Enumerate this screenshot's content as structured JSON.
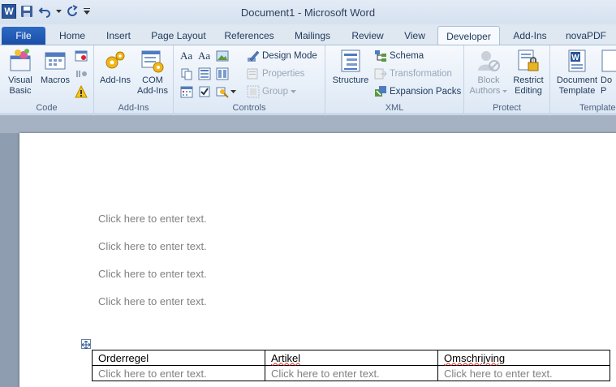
{
  "window": {
    "title": "Document1  -  Microsoft Word"
  },
  "quick_access": {
    "app_icon": "W",
    "save_icon": "save-icon",
    "undo_icon": "undo-icon",
    "redo_icon": "redo-icon",
    "customize_icon": "customize-qat-icon"
  },
  "tabs": [
    {
      "label": "File"
    },
    {
      "label": "Home"
    },
    {
      "label": "Insert"
    },
    {
      "label": "Page Layout"
    },
    {
      "label": "References"
    },
    {
      "label": "Mailings"
    },
    {
      "label": "Review"
    },
    {
      "label": "View"
    },
    {
      "label": "Developer"
    },
    {
      "label": "Add-Ins"
    },
    {
      "label": "novaPDF"
    }
  ],
  "active_tab": "Developer",
  "ribbon": {
    "code": {
      "label": "Code",
      "visual_basic_1": "Visual",
      "visual_basic_2": "Basic",
      "macros": "Macros"
    },
    "addins": {
      "label": "Add-Ins",
      "addins": "Add-Ins",
      "com_1": "COM",
      "com_2": "Add-Ins"
    },
    "controls": {
      "label": "Controls",
      "design_mode": "Design Mode",
      "properties": "Properties",
      "group": "Group"
    },
    "xml": {
      "label": "XML",
      "structure": "Structure",
      "schema": "Schema",
      "transformation": "Transformation",
      "expansion_packs": "Expansion Packs"
    },
    "protect": {
      "label": "Protect",
      "block_1": "Block",
      "block_2": "Authors",
      "restrict_1": "Restrict",
      "restrict_2": "Editing"
    },
    "templates": {
      "label": "Templates",
      "doc_template_1": "Document",
      "doc_template_2": "Template",
      "doc_panel_1": "Do",
      "doc_panel_2": "P"
    }
  },
  "document": {
    "placeholders": [
      "Click here to enter text.",
      "Click here to enter text.",
      "Click here to enter text.",
      "Click here to enter text."
    ],
    "table": {
      "headers": [
        "Orderregel",
        "Artikel",
        "Omschrijving"
      ],
      "row": [
        "Click here to enter text.",
        "Click here to enter text.",
        "Click here to enter text."
      ]
    }
  }
}
